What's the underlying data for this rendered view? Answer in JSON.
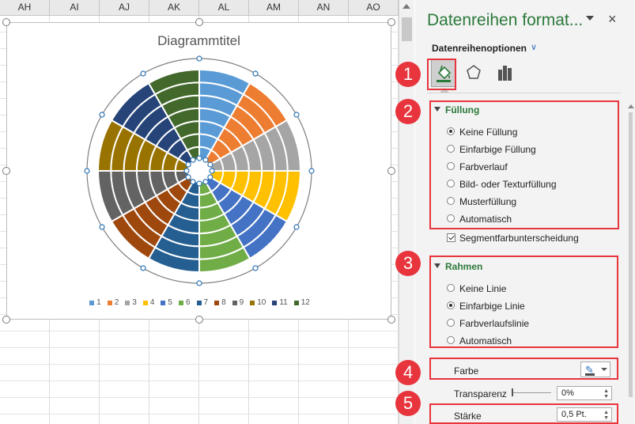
{
  "sheet": {
    "columns": [
      "AH",
      "AI",
      "AJ",
      "AK",
      "AL",
      "AM",
      "AN",
      "AO"
    ]
  },
  "chart": {
    "title": "Diagrammtitel",
    "legend": [
      "1",
      "2",
      "3",
      "4",
      "5",
      "6",
      "7",
      "8",
      "9",
      "10",
      "11",
      "12"
    ],
    "colors": [
      "#5b9bd5",
      "#ed7d31",
      "#a5a5a5",
      "#ffc000",
      "#4472c4",
      "#70ad47",
      "#255e91",
      "#9e480e",
      "#636363",
      "#997300",
      "#264478",
      "#43682b"
    ]
  },
  "chart_data": {
    "type": "doughnut",
    "title": "Diagrammtitel",
    "rings": 7,
    "categories": [
      "1",
      "2",
      "3",
      "4",
      "5",
      "6",
      "7",
      "8",
      "9",
      "10",
      "11",
      "12"
    ],
    "values": [
      1,
      1,
      1,
      1,
      1,
      1,
      1,
      1,
      1,
      1,
      1,
      1
    ],
    "legend_position": "bottom"
  },
  "pane": {
    "title": "Datenreihen format...",
    "close": "×",
    "subtitle": "Datenreihenoptionen",
    "subtitle_chevron": "∨",
    "icons": {
      "fill": "paint-bucket-icon",
      "effects": "pentagon-icon",
      "series": "bar-chart-icon"
    },
    "fill_section": {
      "title": "Füllung",
      "options": [
        "Keine Füllung",
        "Einfarbige Füllung",
        "Farbverlauf",
        "Bild- oder Texturfüllung",
        "Musterfüllung",
        "Automatisch"
      ],
      "selected": "Keine Füllung",
      "vary_colors": "Segmentfarbunterscheidung",
      "vary_colors_checked": true
    },
    "border_section": {
      "title": "Rahmen",
      "options": [
        "Keine Linie",
        "Einfarbige Linie",
        "Farbverlaufslinie",
        "Automatisch"
      ],
      "selected": "Einfarbige Linie"
    },
    "color_label": "Farbe",
    "transparency_label": "Transparenz",
    "transparency_value": "0%",
    "width_label": "Stärke",
    "width_value": "0,5 Pt.",
    "spin_up": "▲",
    "spin_down": "▼"
  },
  "callouts": [
    "1",
    "2",
    "3",
    "4",
    "5"
  ],
  "accent": "#e8343c"
}
